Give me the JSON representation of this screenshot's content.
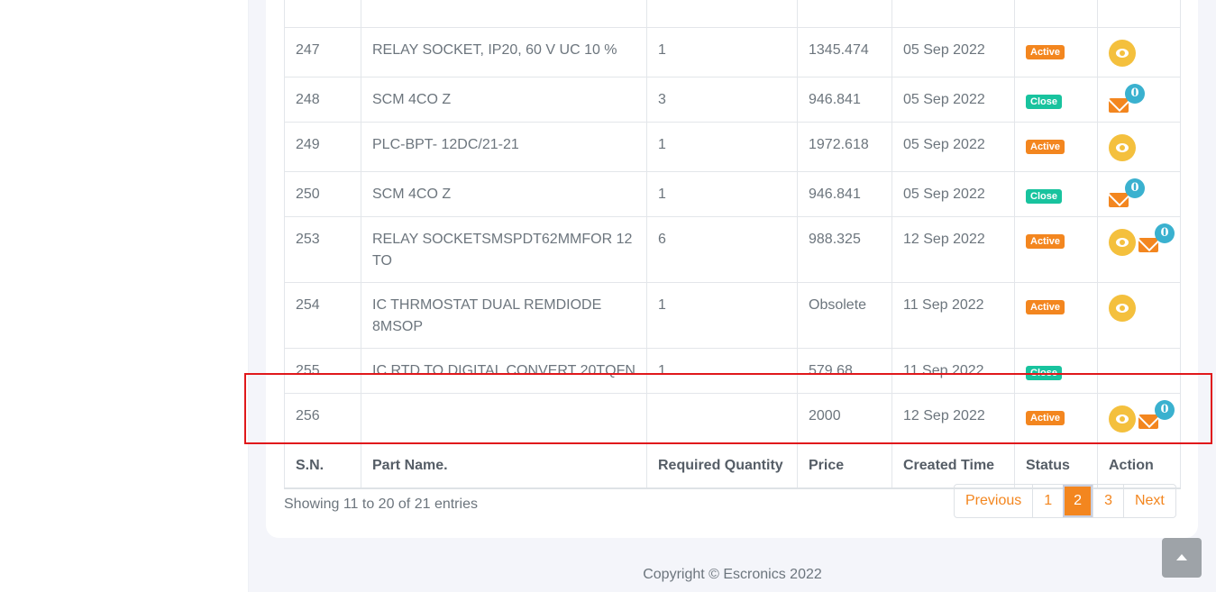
{
  "table": {
    "headers": [
      "S.N.",
      "Part Name.",
      "Required Quantity",
      "Price",
      "Created Time",
      "Status",
      "Action"
    ],
    "rows": [
      {
        "sn": "",
        "part": "",
        "qty": "",
        "price": "",
        "time": "",
        "status": "",
        "status_type": "",
        "eye": true,
        "mail": false,
        "count": ""
      },
      {
        "sn": "247",
        "part": "RELAY SOCKET, IP20, 60 V UC 10 %",
        "qty": "1",
        "price": "1345.474",
        "time": "05 Sep 2022",
        "status": "Active",
        "status_type": "active",
        "eye": true,
        "mail": false,
        "count": ""
      },
      {
        "sn": "248",
        "part": "SCM 4CO Z",
        "qty": "3",
        "price": "946.841",
        "time": "05 Sep 2022",
        "status": "Close",
        "status_type": "close",
        "eye": false,
        "mail": true,
        "count": "0"
      },
      {
        "sn": "249",
        "part": "PLC-BPT- 12DC/21-21",
        "qty": "1",
        "price": "1972.618",
        "time": "05 Sep 2022",
        "status": "Active",
        "status_type": "active",
        "eye": true,
        "mail": false,
        "count": ""
      },
      {
        "sn": "250",
        "part": "SCM 4CO Z",
        "qty": "1",
        "price": "946.841",
        "time": "05 Sep 2022",
        "status": "Close",
        "status_type": "close",
        "eye": false,
        "mail": true,
        "count": "0"
      },
      {
        "sn": "253",
        "part": "RELAY SOCKETSMSPDT62MMFOR 12 TO",
        "qty": "6",
        "price": "988.325",
        "time": "12 Sep 2022",
        "status": "Active",
        "status_type": "active",
        "eye": true,
        "mail": true,
        "count": "0"
      },
      {
        "sn": "254",
        "part": "IC THRMOSTAT DUAL REMDIODE 8MSOP",
        "qty": "1",
        "price": "Obsolete",
        "time": "11 Sep 2022",
        "status": "Active",
        "status_type": "active",
        "eye": true,
        "mail": false,
        "count": ""
      },
      {
        "sn": "255",
        "part": "IC RTD TO DIGITAL CONVERT 20TQFN",
        "qty": "1",
        "price": "579.68",
        "time": "11 Sep 2022",
        "status": "Close",
        "status_type": "close",
        "eye": false,
        "mail": false,
        "count": ""
      },
      {
        "sn": "256",
        "part": "",
        "qty": "",
        "price": "2000",
        "time": "12 Sep 2022",
        "status": "Active",
        "status_type": "active",
        "eye": true,
        "mail": true,
        "count": "0"
      }
    ]
  },
  "pagination": {
    "info": "Showing 11 to 20 of 21 entries",
    "previous": "Previous",
    "pages": [
      "1",
      "2",
      "3"
    ],
    "current": "2",
    "next": "Next"
  },
  "footer": {
    "copyright": "Copyright © Escronics 2022"
  },
  "colors": {
    "accent": "#f3861f",
    "close": "#18c39e",
    "eye": "#f4c03d",
    "count": "#3ab1cf",
    "highlight": "#e0181b"
  }
}
